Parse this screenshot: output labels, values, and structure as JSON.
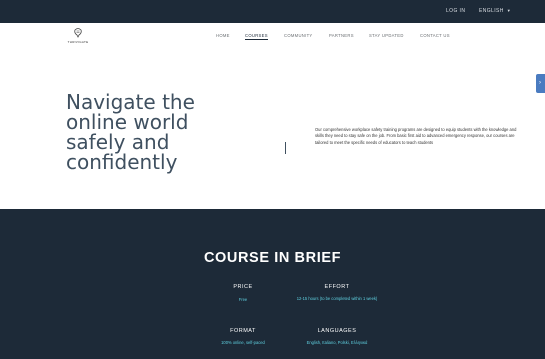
{
  "topbar": {
    "login_label": "LOG IN",
    "language_label": "ENGLISH"
  },
  "logo": {
    "text": "THRIVIGATE"
  },
  "nav": {
    "items": [
      "HOME",
      "COURSES",
      "COMMUNITY",
      "PARTNERS",
      "STAY UPDATED",
      "CONTACT US"
    ],
    "active": "COURSES"
  },
  "hero": {
    "title": "Navigate the\nonline world\nsafely and\nconfidently",
    "description": "Our comprehensive workplace safety training programs are designed to equip students with the knowledge and skills they need to stay safe on the job. From basic first aid to advanced emergency response, our courses are tailored to meet the specific needs of educators to teach students"
  },
  "brief": {
    "title": "COURSE IN BRIEF",
    "price": {
      "label": "PRICE",
      "value": "Free"
    },
    "effort": {
      "label": "EFFORT",
      "value": "12-15 hours (to be completed within 1 week)"
    },
    "format": {
      "label": "FORMAT",
      "value": "100% online, self-paced"
    },
    "languages": {
      "label": "LANGUAGES",
      "value": "English, Italiano, Polski, Ελληνικά"
    }
  },
  "colors": {
    "dark_bg": "#1d2a38",
    "accent_cyan": "#5fd0e0",
    "hero_text": "#3f5060",
    "side_tab": "#4a7bc0"
  },
  "icons": {
    "logo": "thrivigate-logo-icon",
    "language_dropdown": "chevron-down-icon",
    "side_tab": "side-feedback-tab-icon"
  }
}
